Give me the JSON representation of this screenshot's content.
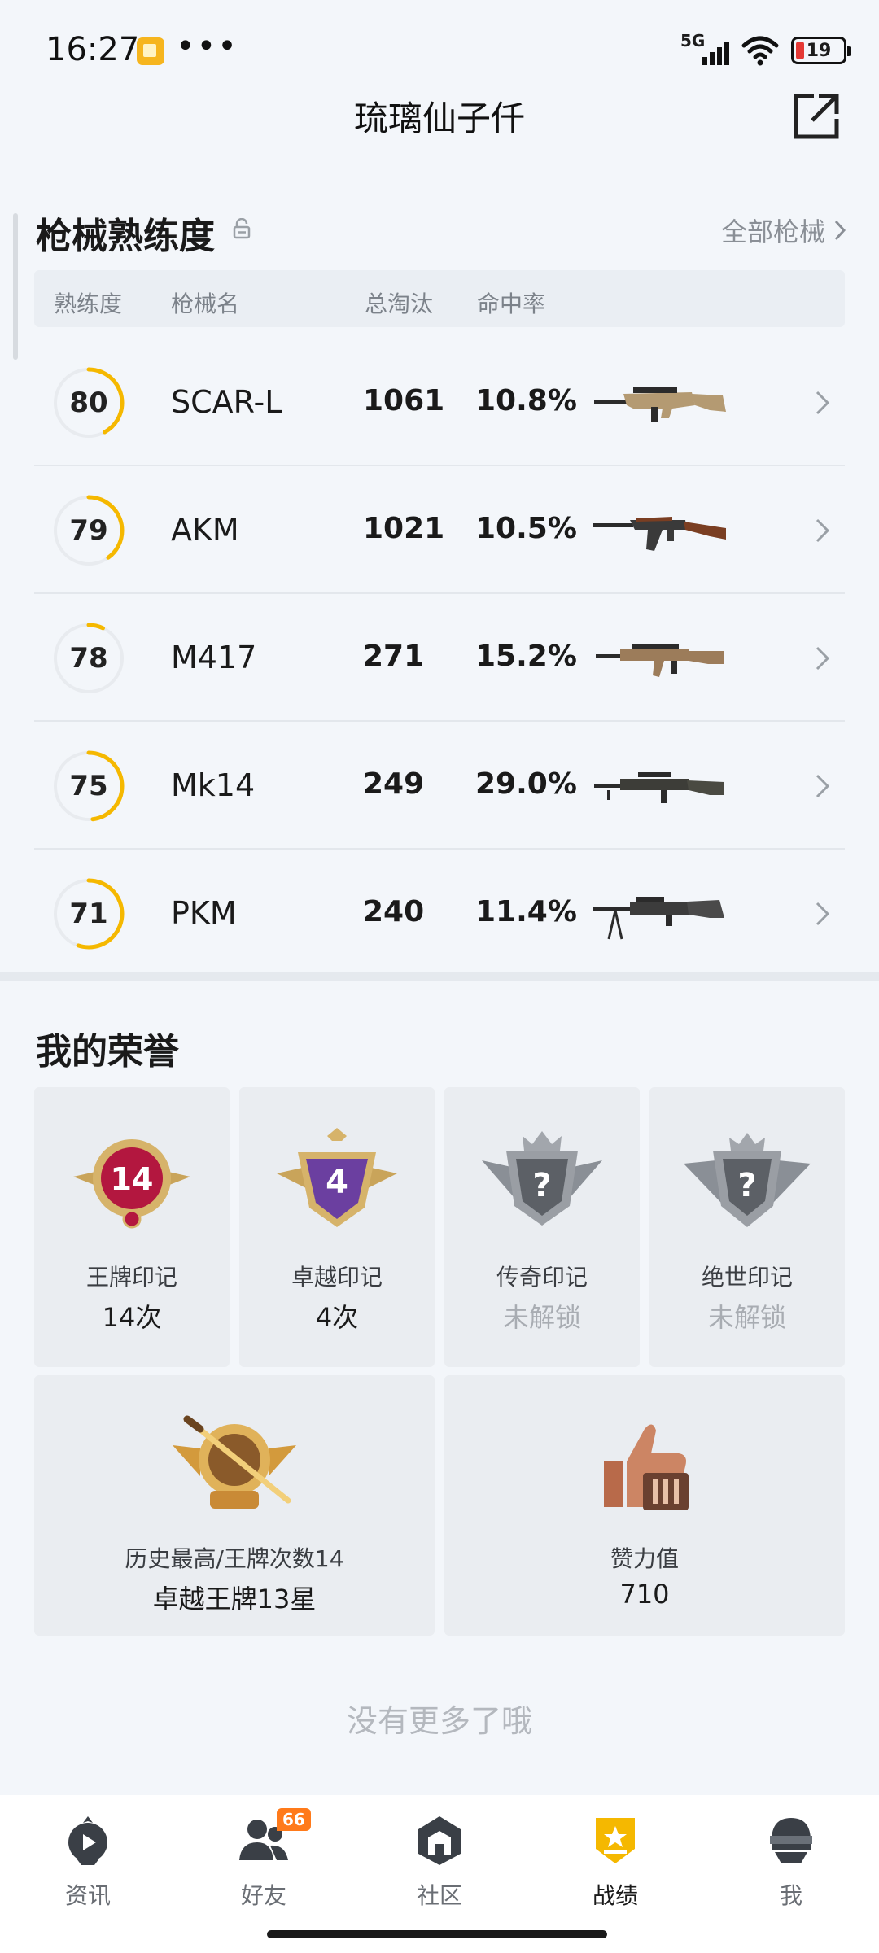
{
  "status_bar": {
    "time": "16:27",
    "network": "5G",
    "battery": "19"
  },
  "header": {
    "title": "琉璃仙子仟"
  },
  "weapons": {
    "title": "枪械熟练度",
    "all_link": "全部枪械",
    "columns": {
      "proficiency": "熟练度",
      "name": "枪械名",
      "kills": "总淘汰",
      "hit_rate": "命中率"
    },
    "rows": [
      {
        "proficiency": "80",
        "progress": 0.42,
        "name": "SCAR-L",
        "kills": "1061",
        "hit_rate": "10.8%"
      },
      {
        "proficiency": "79",
        "progress": 0.4,
        "name": "AKM",
        "kills": "1021",
        "hit_rate": "10.5%"
      },
      {
        "proficiency": "78",
        "progress": 0.07,
        "name": "M417",
        "kills": "271",
        "hit_rate": "15.2%"
      },
      {
        "proficiency": "75",
        "progress": 0.48,
        "name": "Mk14",
        "kills": "249",
        "hit_rate": "29.0%"
      },
      {
        "proficiency": "71",
        "progress": 0.55,
        "name": "PKM",
        "kills": "240",
        "hit_rate": "11.4%"
      }
    ]
  },
  "honors": {
    "title": "我的荣誉",
    "badges": [
      {
        "label": "王牌印记",
        "value": "14次",
        "badge_text": "14",
        "locked": false
      },
      {
        "label": "卓越印记",
        "value": "4次",
        "badge_text": "4",
        "locked": false
      },
      {
        "label": "传奇印记",
        "value": "未解锁",
        "badge_text": "?",
        "locked": true
      },
      {
        "label": "绝世印记",
        "value": "未解锁",
        "badge_text": "?",
        "locked": true
      }
    ],
    "best": {
      "label": "历史最高/王牌次数14",
      "value": "卓越王牌13星"
    },
    "likes": {
      "label": "赞力值",
      "value": "710"
    }
  },
  "footer_text": "没有更多了哦",
  "nav": {
    "items": [
      {
        "label": "资讯",
        "icon": "news-icon"
      },
      {
        "label": "好友",
        "icon": "friends-icon",
        "badge": "66"
      },
      {
        "label": "社区",
        "icon": "community-icon"
      },
      {
        "label": "战绩",
        "icon": "record-icon",
        "active": true
      },
      {
        "label": "我",
        "icon": "profile-icon"
      }
    ]
  },
  "colors": {
    "accent": "#f5b800",
    "ring_track": "#e8ebef"
  }
}
